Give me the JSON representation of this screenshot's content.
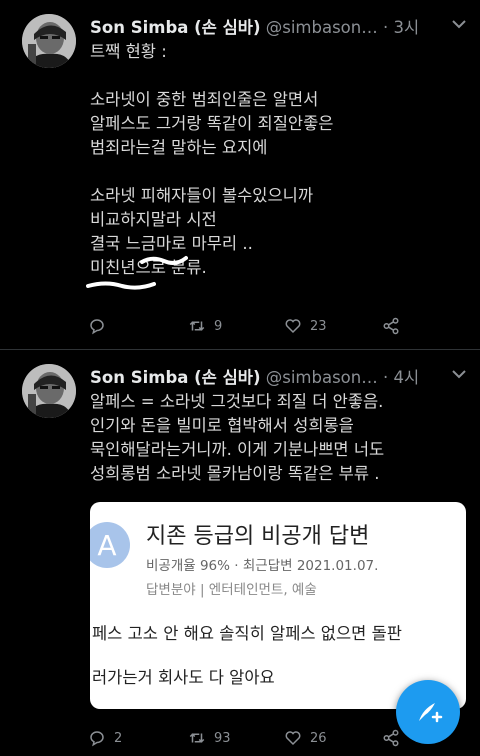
{
  "tweets": [
    {
      "name": "Son Simba (손 심바)",
      "handle": "@simbason…",
      "dot": "·",
      "time": "3시",
      "lines": [
        "트짹 현황 :",
        "",
        "소라넷이 중한 범죄인줄은 알면서",
        "알페스도 그거랑 똑같이 죄질안좋은",
        "범죄라는걸 말하는 요지에",
        "",
        "소라넷  피해자들이 볼수있으니까",
        "비교하지말라 시전",
        "결국 느금마로 마무리 ..",
        "미친년으로 분류."
      ],
      "replies": "",
      "retweets": "9",
      "likes": "23"
    },
    {
      "name": "Son Simba (손 심바)",
      "handle": "@simbason…",
      "dot": "·",
      "time": "4시",
      "lines": [
        "알페스 = 소라넷 그것보다 죄질 더 안좋음.",
        "인기와 돈을 빌미로 협박해서 성희롱을",
        "묵인해달라는거니까. 이게 기분나쁘면 너도",
        "성희롱범 소라넷 몰카남이랑 똑같은 부류 ."
      ],
      "card": {
        "icon_letter": "A",
        "title": "지존 등급의 비공개 답변",
        "meta": "비공개율 96%  ·  최근답변 2021.01.07.",
        "meta2": "답변분야 | 엔터테인먼트, 예술",
        "answer_line1": "페스 고소 안 해요 솔직히 알페스 없으면 돌판",
        "answer_line2": "러가는거 회사도 다 알아요"
      },
      "replies": "2",
      "retweets": "93",
      "likes": "26"
    }
  ],
  "icons": {
    "reply": "reply-icon",
    "retweet": "retweet-icon",
    "like": "heart-icon",
    "share": "share-icon",
    "compose": "compose-tweet-icon"
  },
  "colors": {
    "background": "#000000",
    "text": "#d9d9d9",
    "muted": "#8b8f94",
    "accent": "#1d9bf0"
  }
}
